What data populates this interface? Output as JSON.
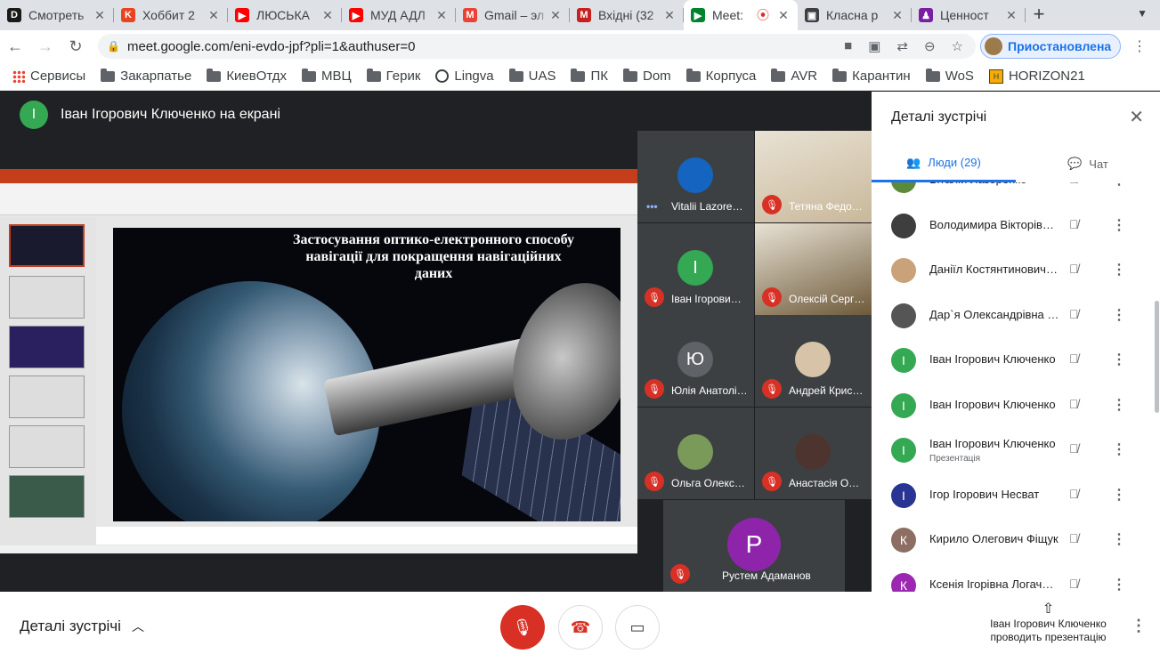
{
  "browser": {
    "tabs": [
      {
        "title": "Смотреть",
        "fav_color": "#1a1a1a",
        "fav_text": "D",
        "active": false
      },
      {
        "title": "Хоббит 2",
        "fav_color": "#e8451e",
        "fav_text": "K",
        "active": false
      },
      {
        "title": "ЛЮСЬКА",
        "fav_color": "#ff0000",
        "fav_text": "▶",
        "active": false
      },
      {
        "title": "МУД АДЛ",
        "fav_color": "#ff0000",
        "fav_text": "▶",
        "active": false
      },
      {
        "title": "Gmail – эл",
        "fav_color": "#ea4335",
        "fav_text": "M",
        "active": false
      },
      {
        "title": "Вхідні (32",
        "fav_color": "#c5221f",
        "fav_text": "M",
        "active": false
      },
      {
        "title": "Meet:",
        "fav_color": "#00832d",
        "fav_text": "▶",
        "active": true
      },
      {
        "title": "Класна р",
        "fav_color": "#3c4043",
        "fav_text": "▣",
        "active": false
      },
      {
        "title": "Ценност",
        "fav_color": "#7b1fa2",
        "fav_text": "♟",
        "active": false
      }
    ],
    "url": "meet.google.com/eni-evdo-jpf?pli=1&authuser=0",
    "profile_label": "Приостановлена",
    "bookmarks": [
      {
        "label": "Сервисы",
        "icon": "apps-grid-icon"
      },
      {
        "label": "Закарпатье",
        "icon": "folder-icon"
      },
      {
        "label": "КиевОтдх",
        "icon": "folder-icon"
      },
      {
        "label": "МВЦ",
        "icon": "folder-icon"
      },
      {
        "label": "Герик",
        "icon": "folder-icon"
      },
      {
        "label": "Lingva",
        "icon": "globe-icon"
      },
      {
        "label": "UAS",
        "icon": "folder-icon"
      },
      {
        "label": "ПК",
        "icon": "folder-icon"
      },
      {
        "label": "Dom",
        "icon": "folder-icon"
      },
      {
        "label": "Корпуса",
        "icon": "folder-icon"
      },
      {
        "label": "AVR",
        "icon": "folder-icon"
      },
      {
        "label": "Карантин",
        "icon": "folder-icon"
      },
      {
        "label": "WoS",
        "icon": "folder-icon"
      },
      {
        "label": "HORIZON21",
        "icon": "horizon-icon"
      }
    ]
  },
  "meet": {
    "presenter": {
      "initial": "І",
      "label": "Іван Ігорович Ключенко на екрані",
      "color": "#34a853"
    },
    "slide_title": "Застосування оптико-електронного способу навігації для покращення навігаційних даних",
    "tiles": [
      {
        "name": "Vitalii Lazore…",
        "muted": false,
        "kind": "photo",
        "color": "#1565c0"
      },
      {
        "name": "Тетяна Федо…",
        "muted": true,
        "kind": "photo",
        "color": "#c9b89a"
      },
      {
        "name": "Іван Ігорови…",
        "muted": true,
        "kind": "initial",
        "initial": "І",
        "color": "#34a853"
      },
      {
        "name": "Олексій Серг…",
        "muted": true,
        "kind": "photo",
        "color": "#6e5a3a"
      },
      {
        "name": "Юлія Анатолі…",
        "muted": true,
        "kind": "initial",
        "initial": "Ю",
        "color": "#5f6368"
      },
      {
        "name": "Андрей Крис…",
        "muted": true,
        "kind": "photo",
        "color": "#d7c4a8"
      },
      {
        "name": "Ольга Олекс…",
        "muted": true,
        "kind": "photo",
        "color": "#7a9a5a"
      },
      {
        "name": "Анастасія О…",
        "muted": true,
        "kind": "photo",
        "color": "#4e342e"
      },
      {
        "name": "Рустем Адаманов",
        "muted": true,
        "kind": "initial",
        "initial": "Р",
        "color": "#8e24aa"
      }
    ],
    "details": {
      "title": "Деталі зустрічі",
      "tab_people": "Люди (29)",
      "tab_chat": "Чат",
      "people": [
        {
          "name": "Віталій Лазоренко",
          "color": "#5d8a3a",
          "initial": "",
          "sub": ""
        },
        {
          "name": "Володимира Вікторівна …",
          "color": "#3e3e3e",
          "initial": "",
          "sub": ""
        },
        {
          "name": "Даніїл Костянтинович …",
          "color": "#c9a27a",
          "initial": "",
          "sub": ""
        },
        {
          "name": "Дар`я Олександрівна …",
          "color": "#555",
          "initial": "",
          "sub": ""
        },
        {
          "name": "Іван Ігорович Ключенко",
          "color": "#34a853",
          "initial": "І",
          "sub": ""
        },
        {
          "name": "Іван Ігорович Ключенко",
          "color": "#34a853",
          "initial": "І",
          "sub": ""
        },
        {
          "name": "Іван Ігорович Ключенко",
          "color": "#34a853",
          "initial": "І",
          "sub": "Презентація"
        },
        {
          "name": "Ігор Ігорович Несват",
          "color": "#283593",
          "initial": "І",
          "sub": ""
        },
        {
          "name": "Кирило Олегович Фіщук",
          "color": "#8d6e63",
          "initial": "К",
          "sub": ""
        },
        {
          "name": "Ксенія Ігорівна Логачо…",
          "color": "#9c27b0",
          "initial": "К",
          "sub": ""
        }
      ]
    },
    "bottom": {
      "details_label": "Деталі зустрічі",
      "presenting_line1": "Іван Ігорович Ключенко",
      "presenting_line2": "проводить презентацію"
    }
  }
}
